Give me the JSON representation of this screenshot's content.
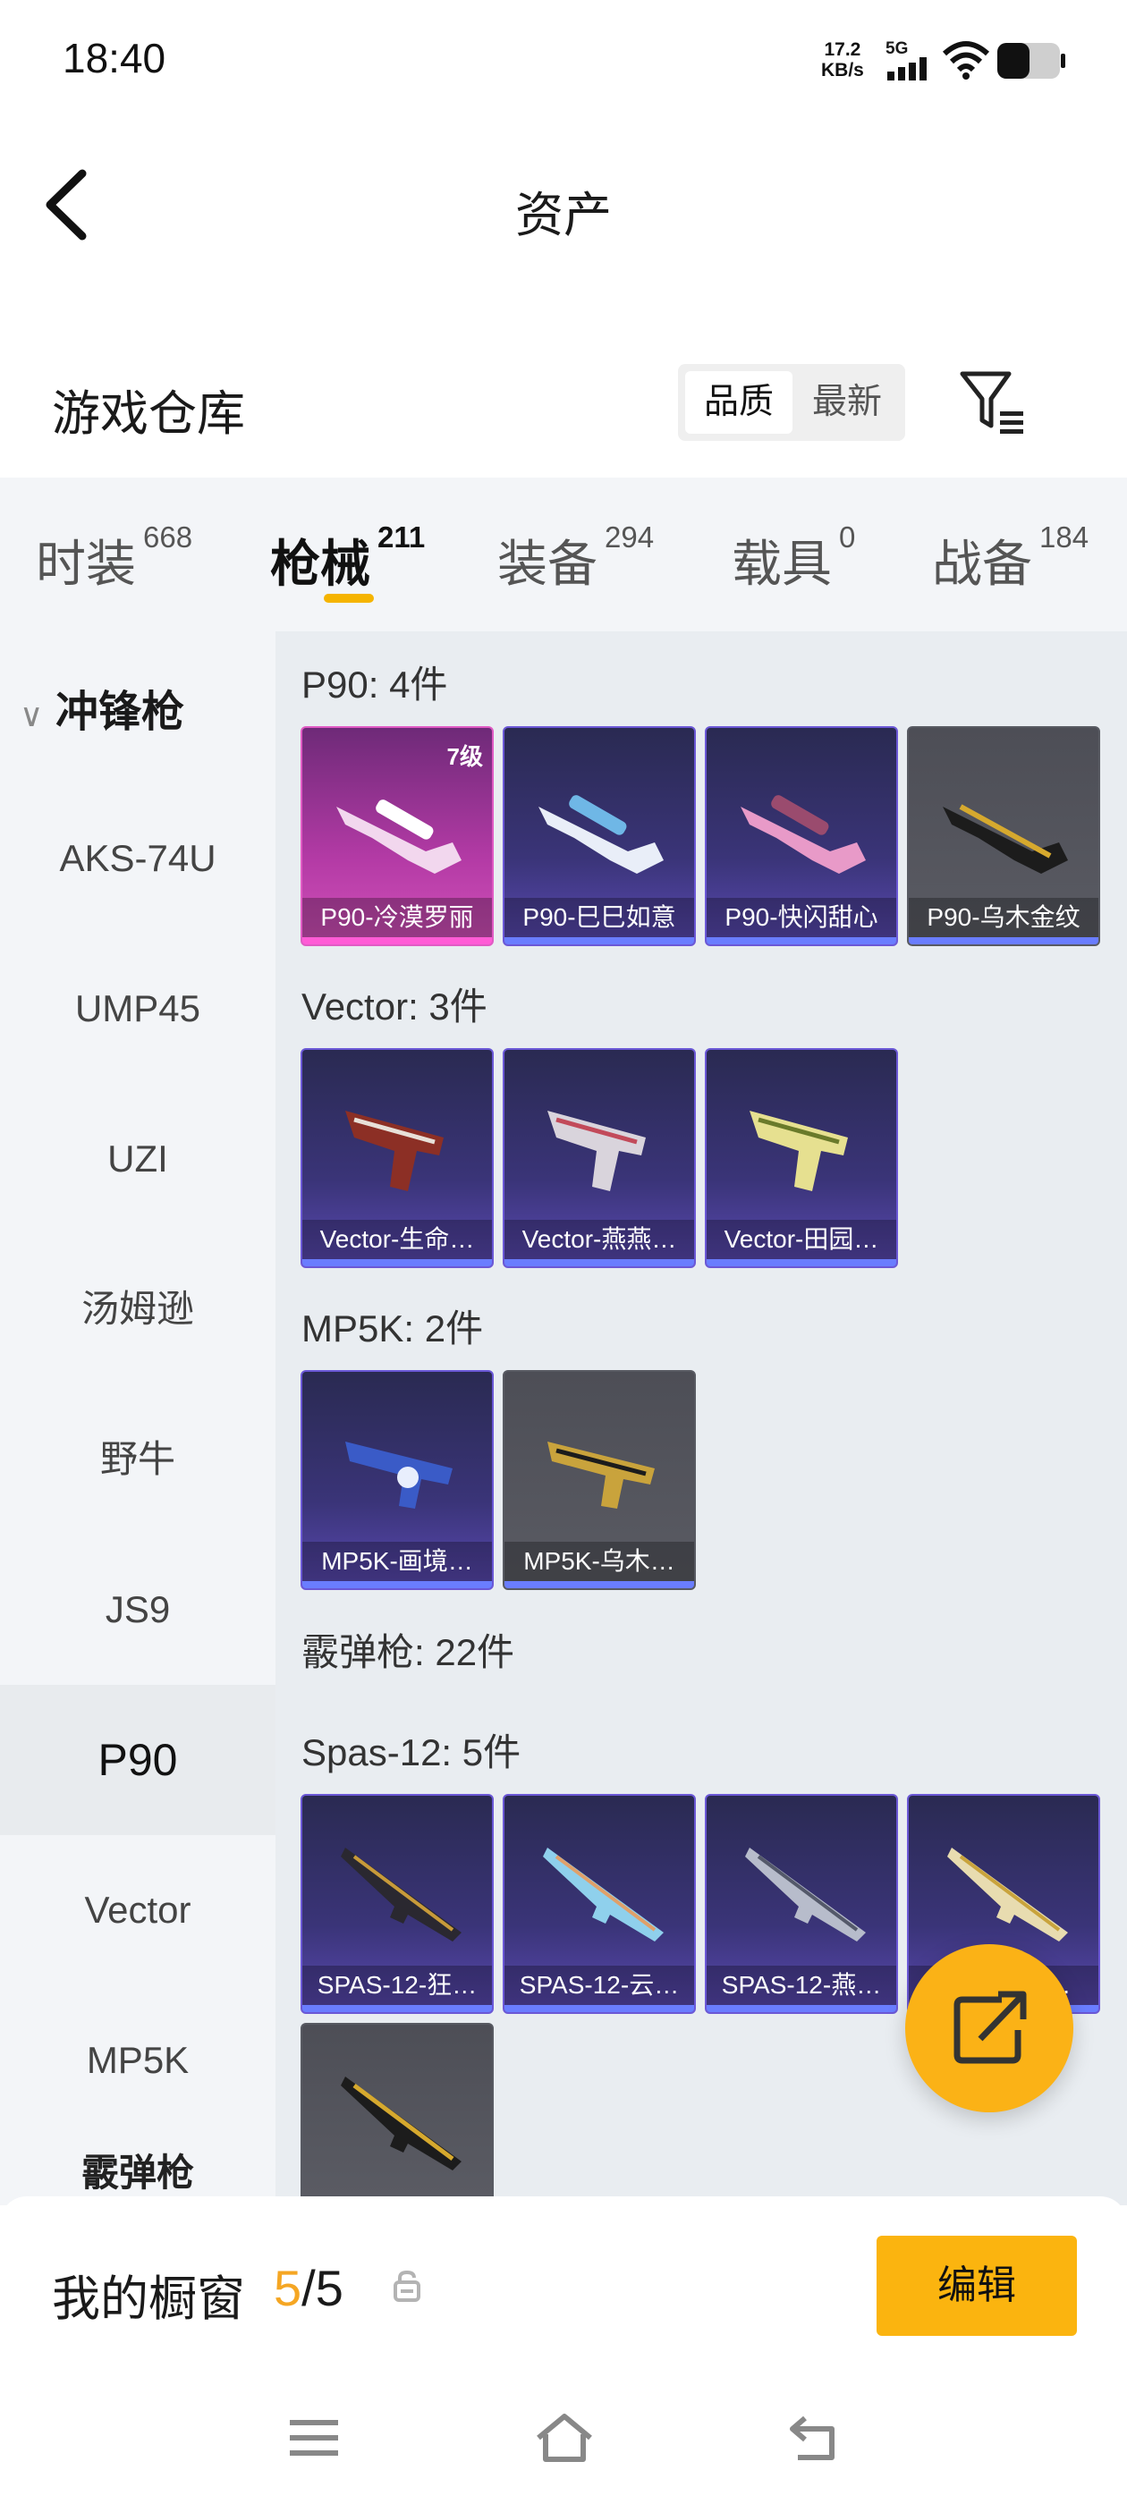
{
  "status": {
    "time": "18:40",
    "net_speed": "17.2",
    "net_unit": "KB/s",
    "signal_label": "5G"
  },
  "header": {
    "title": "资产"
  },
  "section": {
    "title": "游戏仓库",
    "sort_options": [
      "品质",
      "最新"
    ],
    "sort_active": "品质"
  },
  "tabs": [
    {
      "label": "时装",
      "count": "668"
    },
    {
      "label": "枪械",
      "count": "211",
      "active": true
    },
    {
      "label": "装备",
      "count": "294"
    },
    {
      "label": "载具",
      "count": "0"
    },
    {
      "label": "战备",
      "count": "184"
    }
  ],
  "sidebar": {
    "heading": "冲锋枪",
    "items": [
      "AKS-74U",
      "UMP45",
      "UZI",
      "汤姆逊",
      "野牛",
      "JS9",
      "P90",
      "Vector",
      "MP5K"
    ],
    "selected": "P90",
    "next_heading": "霰弹枪"
  },
  "groups": [
    {
      "title": "P90: 4件",
      "cards": [
        {
          "label": "P90-冷漠罗丽",
          "rarity": "pink",
          "level": "7级",
          "icon": "p90-gun-icon"
        },
        {
          "label": "P90-巳巳如意",
          "rarity": "purple",
          "icon": "p90-gun-icon"
        },
        {
          "label": "P90-快闪甜心",
          "rarity": "purple",
          "icon": "p90-gun-icon"
        },
        {
          "label": "P90-乌木金纹",
          "rarity": "gray",
          "icon": "p90-gun-icon"
        }
      ]
    },
    {
      "title": "Vector: 3件",
      "cards": [
        {
          "label": "Vector-生命…",
          "rarity": "purple",
          "icon": "vector-gun-icon"
        },
        {
          "label": "Vector-燕燕…",
          "rarity": "purple",
          "icon": "vector-gun-icon"
        },
        {
          "label": "Vector-田园…",
          "rarity": "purple",
          "icon": "vector-gun-icon"
        }
      ]
    },
    {
      "title": "MP5K: 2件",
      "cards": [
        {
          "label": "MP5K-画境…",
          "rarity": "purple",
          "icon": "mp5k-gun-icon"
        },
        {
          "label": "MP5K-乌木…",
          "rarity": "gray",
          "icon": "mp5k-gun-icon"
        }
      ]
    },
    {
      "title": "霰弹枪: 22件",
      "cards": []
    },
    {
      "title": "Spas-12: 5件",
      "cards": [
        {
          "label": "SPAS-12-狂…",
          "rarity": "purple",
          "icon": "shotgun-icon"
        },
        {
          "label": "SPAS-12-云…",
          "rarity": "purple",
          "icon": "shotgun-icon"
        },
        {
          "label": "SPAS-12-燕…",
          "rarity": "purple",
          "icon": "shotgun-icon"
        },
        {
          "label": "SPAS-12-…",
          "rarity": "purple",
          "icon": "shotgun-icon"
        },
        {
          "label": "",
          "rarity": "gray",
          "icon": "shotgun-icon"
        }
      ]
    }
  ],
  "showcase": {
    "label": "我的橱窗",
    "current": "5",
    "separator": "/",
    "total": "5",
    "edit_label": "编辑"
  },
  "colors": {
    "accent": "#f5b400",
    "button": "#fbb40f",
    "purple_rarity": "#6b58d6",
    "pink_rarity": "#e05bc4"
  }
}
